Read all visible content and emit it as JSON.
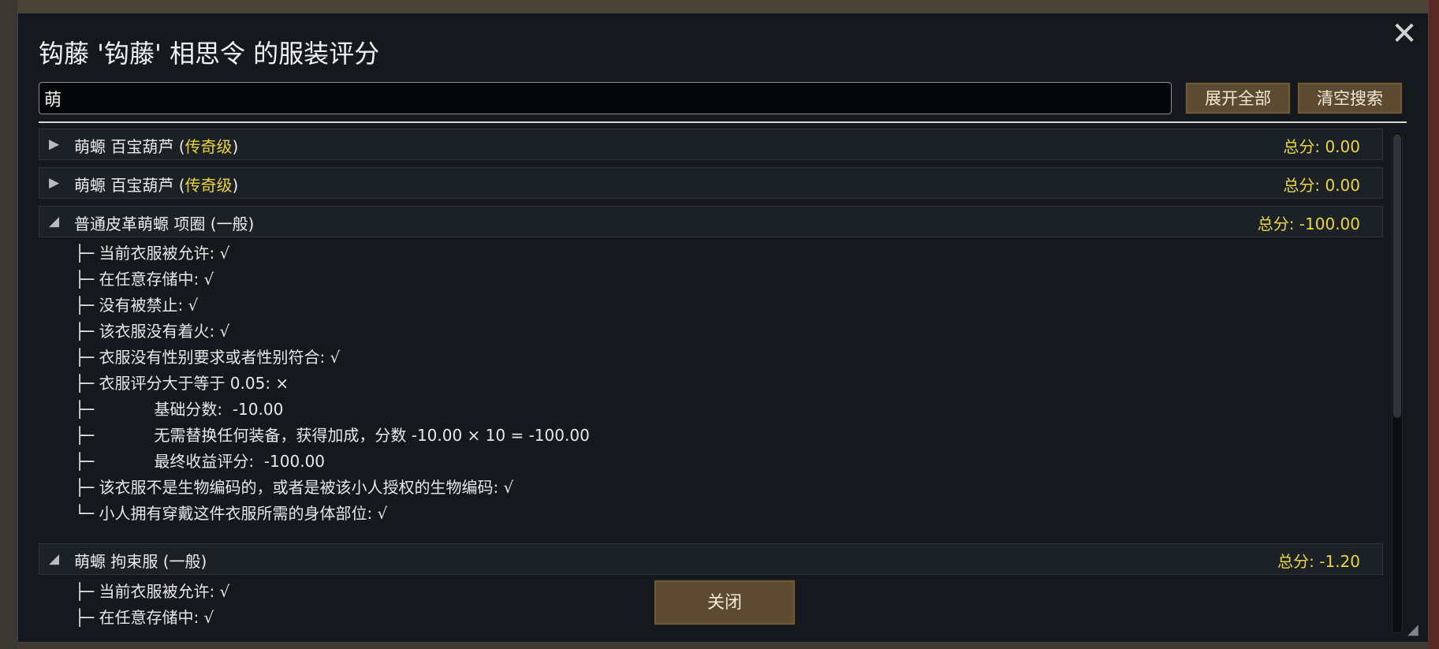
{
  "dialog": {
    "title": "钩藤 '钩藤' 相思令 的服装评分",
    "close_icon": "close-icon",
    "search": {
      "value": "萌"
    },
    "buttons": {
      "expand_all": "展开全部",
      "clear_search": "清空搜索",
      "close": "关闭"
    }
  },
  "apparel": [
    {
      "name_prefix": "萌螈 百宝葫芦 (",
      "quality": "传奇级",
      "name_suffix": ")",
      "score": "总分: 0.00",
      "expanded": false
    },
    {
      "name_prefix": "萌螈 百宝葫芦 (",
      "quality": "传奇级",
      "name_suffix": ")",
      "score": "总分: 0.00",
      "expanded": false
    },
    {
      "name_prefix": "普通皮革萌螈 项圈 (一般)",
      "quality": "",
      "name_suffix": "",
      "score": "总分: -100.00",
      "expanded": true,
      "details": [
        "├─ 当前衣服被允许: √",
        "├─ 在任意存储中: √",
        "├─ 没有被禁止: √",
        "├─ 该衣服没有着火: √",
        "├─ 衣服没有性别要求或者性别符合: √",
        "├─ 衣服评分大于等于 0.05: ×",
        "├─            基础分数:  -10.00",
        "├─            无需替换任何装备，获得加成，分数 -10.00 × 10 = -100.00",
        "├─            最终收益评分:  -100.00",
        "├─ 该衣服不是生物编码的，或者是被该小人授权的生物编码: √",
        "└─ 小人拥有穿戴这件衣服所需的身体部位: √"
      ]
    },
    {
      "name_prefix": "萌螈 拘束服 (一般)",
      "quality": "",
      "name_suffix": "",
      "score": "总分: -1.20",
      "expanded": true,
      "details": [
        "├─ 当前衣服被允许: √",
        "├─ 在任意存储中: √"
      ]
    }
  ],
  "colors": {
    "accent_yellow": "#e9d63f",
    "button_brown": "#5d4b31",
    "panel": "#15191d"
  }
}
